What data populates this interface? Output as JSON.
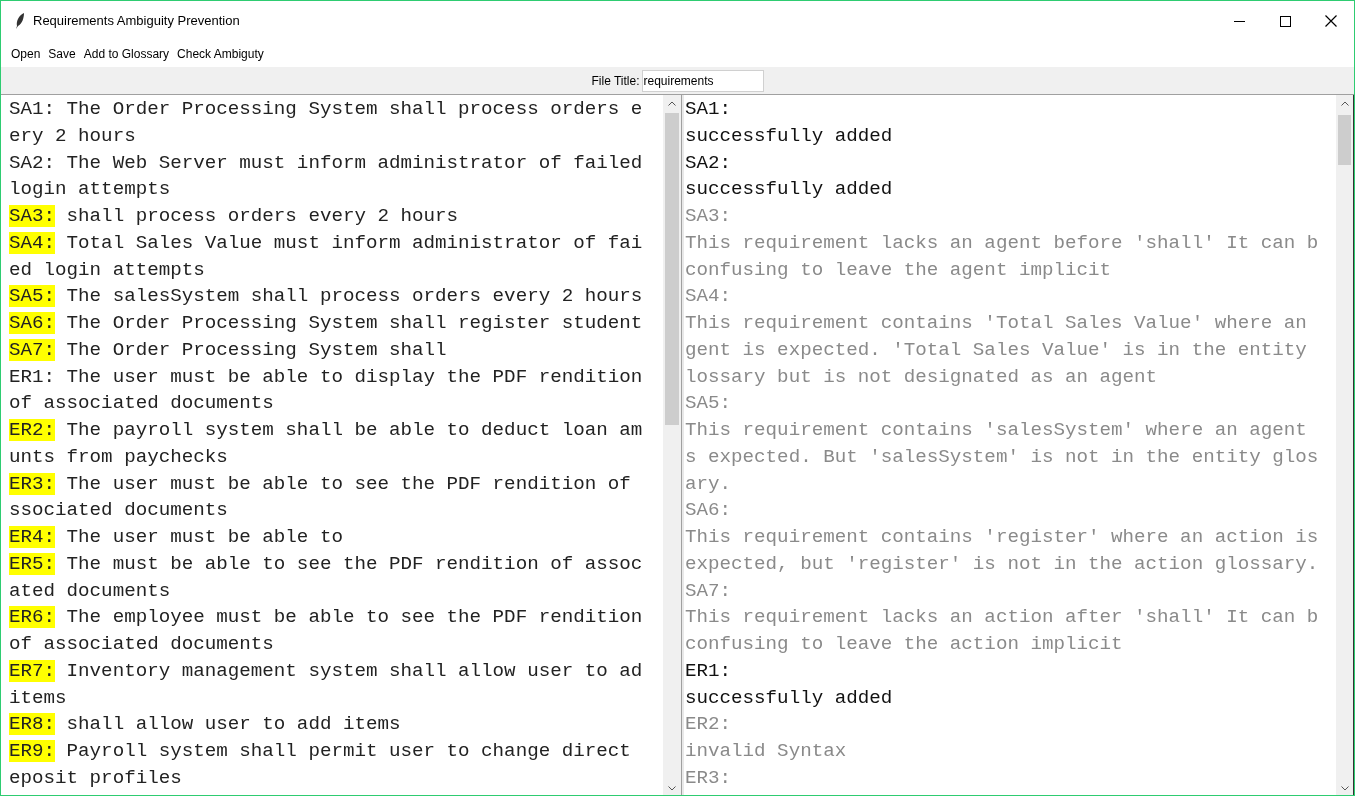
{
  "window": {
    "title": "Requirements Ambiguity Prevention"
  },
  "menu": [
    "Open",
    "Save",
    "Add to Glossary",
    "Check Ambiguty"
  ],
  "file_title": {
    "label": "File Title:",
    "value": "requirements"
  },
  "requirements": [
    {
      "label": "SA1:",
      "highlighted": false,
      "lines": [
        "The Order Processing System shall process orders e",
        "ery 2 hours"
      ]
    },
    {
      "label": "SA2:",
      "highlighted": false,
      "lines": [
        "The Web Server must inform administrator of failed",
        "login attempts"
      ]
    },
    {
      "label": "SA3:",
      "highlighted": true,
      "lines": [
        "shall process orders every 2 hours"
      ]
    },
    {
      "label": "SA4:",
      "highlighted": true,
      "lines": [
        "Total Sales Value must inform administrator of fai",
        "ed login attempts"
      ]
    },
    {
      "label": "SA5:",
      "highlighted": true,
      "lines": [
        "The salesSystem shall process orders every 2 hours"
      ]
    },
    {
      "label": "SA6:",
      "highlighted": true,
      "lines": [
        "The Order Processing System shall register student"
      ]
    },
    {
      "label": "SA7:",
      "highlighted": true,
      "lines": [
        "The Order Processing System shall"
      ]
    },
    {
      "label": "ER1:",
      "highlighted": false,
      "lines": [
        "The user must be able to display the PDF rendition",
        "of associated documents"
      ]
    },
    {
      "label": "ER2:",
      "highlighted": true,
      "lines": [
        "The payroll system shall be able to deduct loan am",
        "unts from paychecks"
      ]
    },
    {
      "label": "ER3:",
      "highlighted": true,
      "lines": [
        "The user must be able to see the PDF rendition of",
        "ssociated documents"
      ]
    },
    {
      "label": "ER4:",
      "highlighted": true,
      "lines": [
        "The user must be able to"
      ]
    },
    {
      "label": "ER5:",
      "highlighted": true,
      "lines": [
        "The must be able to see the PDF rendition of assoc",
        "ated documents"
      ]
    },
    {
      "label": "ER6:",
      "highlighted": true,
      "lines": [
        "The employee must be able to see the PDF rendition",
        "of associated documents"
      ]
    },
    {
      "label": "ER7:",
      "highlighted": true,
      "lines": [
        "Inventory management system shall allow user to ad",
        "items"
      ]
    },
    {
      "label": "ER8:",
      "highlighted": true,
      "lines": [
        "shall allow user to add items"
      ]
    },
    {
      "label": "ER9:",
      "highlighted": true,
      "lines": [
        "Payroll system shall permit user to change direct",
        "eposit profiles"
      ]
    }
  ],
  "results": [
    {
      "label": "SA1:",
      "kind": "ok",
      "lines": [
        "successfully added"
      ]
    },
    {
      "label": "SA2:",
      "kind": "ok",
      "lines": [
        "successfully added"
      ]
    },
    {
      "label": "SA3:",
      "kind": "issue",
      "lines": [
        "This requirement lacks an agent before 'shall' It can b",
        "confusing to leave the agent implicit"
      ]
    },
    {
      "label": "SA4:",
      "kind": "issue",
      "lines": [
        "This requirement contains 'Total Sales Value' where an",
        "gent is expected. 'Total Sales Value' is in the entity",
        "lossary but is not designated as an agent"
      ]
    },
    {
      "label": "SA5:",
      "kind": "issue",
      "lines": [
        "This requirement contains 'salesSystem' where an agent",
        "s expected. But 'salesSystem' is not in the entity glos",
        "ary."
      ]
    },
    {
      "label": "SA6:",
      "kind": "issue",
      "lines": [
        "This requirement contains 'register' where an action is",
        "expected, but 'register' is not in the action glossary."
      ]
    },
    {
      "label": "SA7:",
      "kind": "issue",
      "lines": [
        "This requirement lacks an action after 'shall' It can b",
        "confusing to leave the action implicit"
      ]
    },
    {
      "label": "ER1:",
      "kind": "ok",
      "lines": [
        "successfully added"
      ]
    },
    {
      "label": "ER2:",
      "kind": "issue",
      "lines": [
        "invalid Syntax"
      ]
    },
    {
      "label": "ER3:",
      "kind": "issue"
    }
  ]
}
